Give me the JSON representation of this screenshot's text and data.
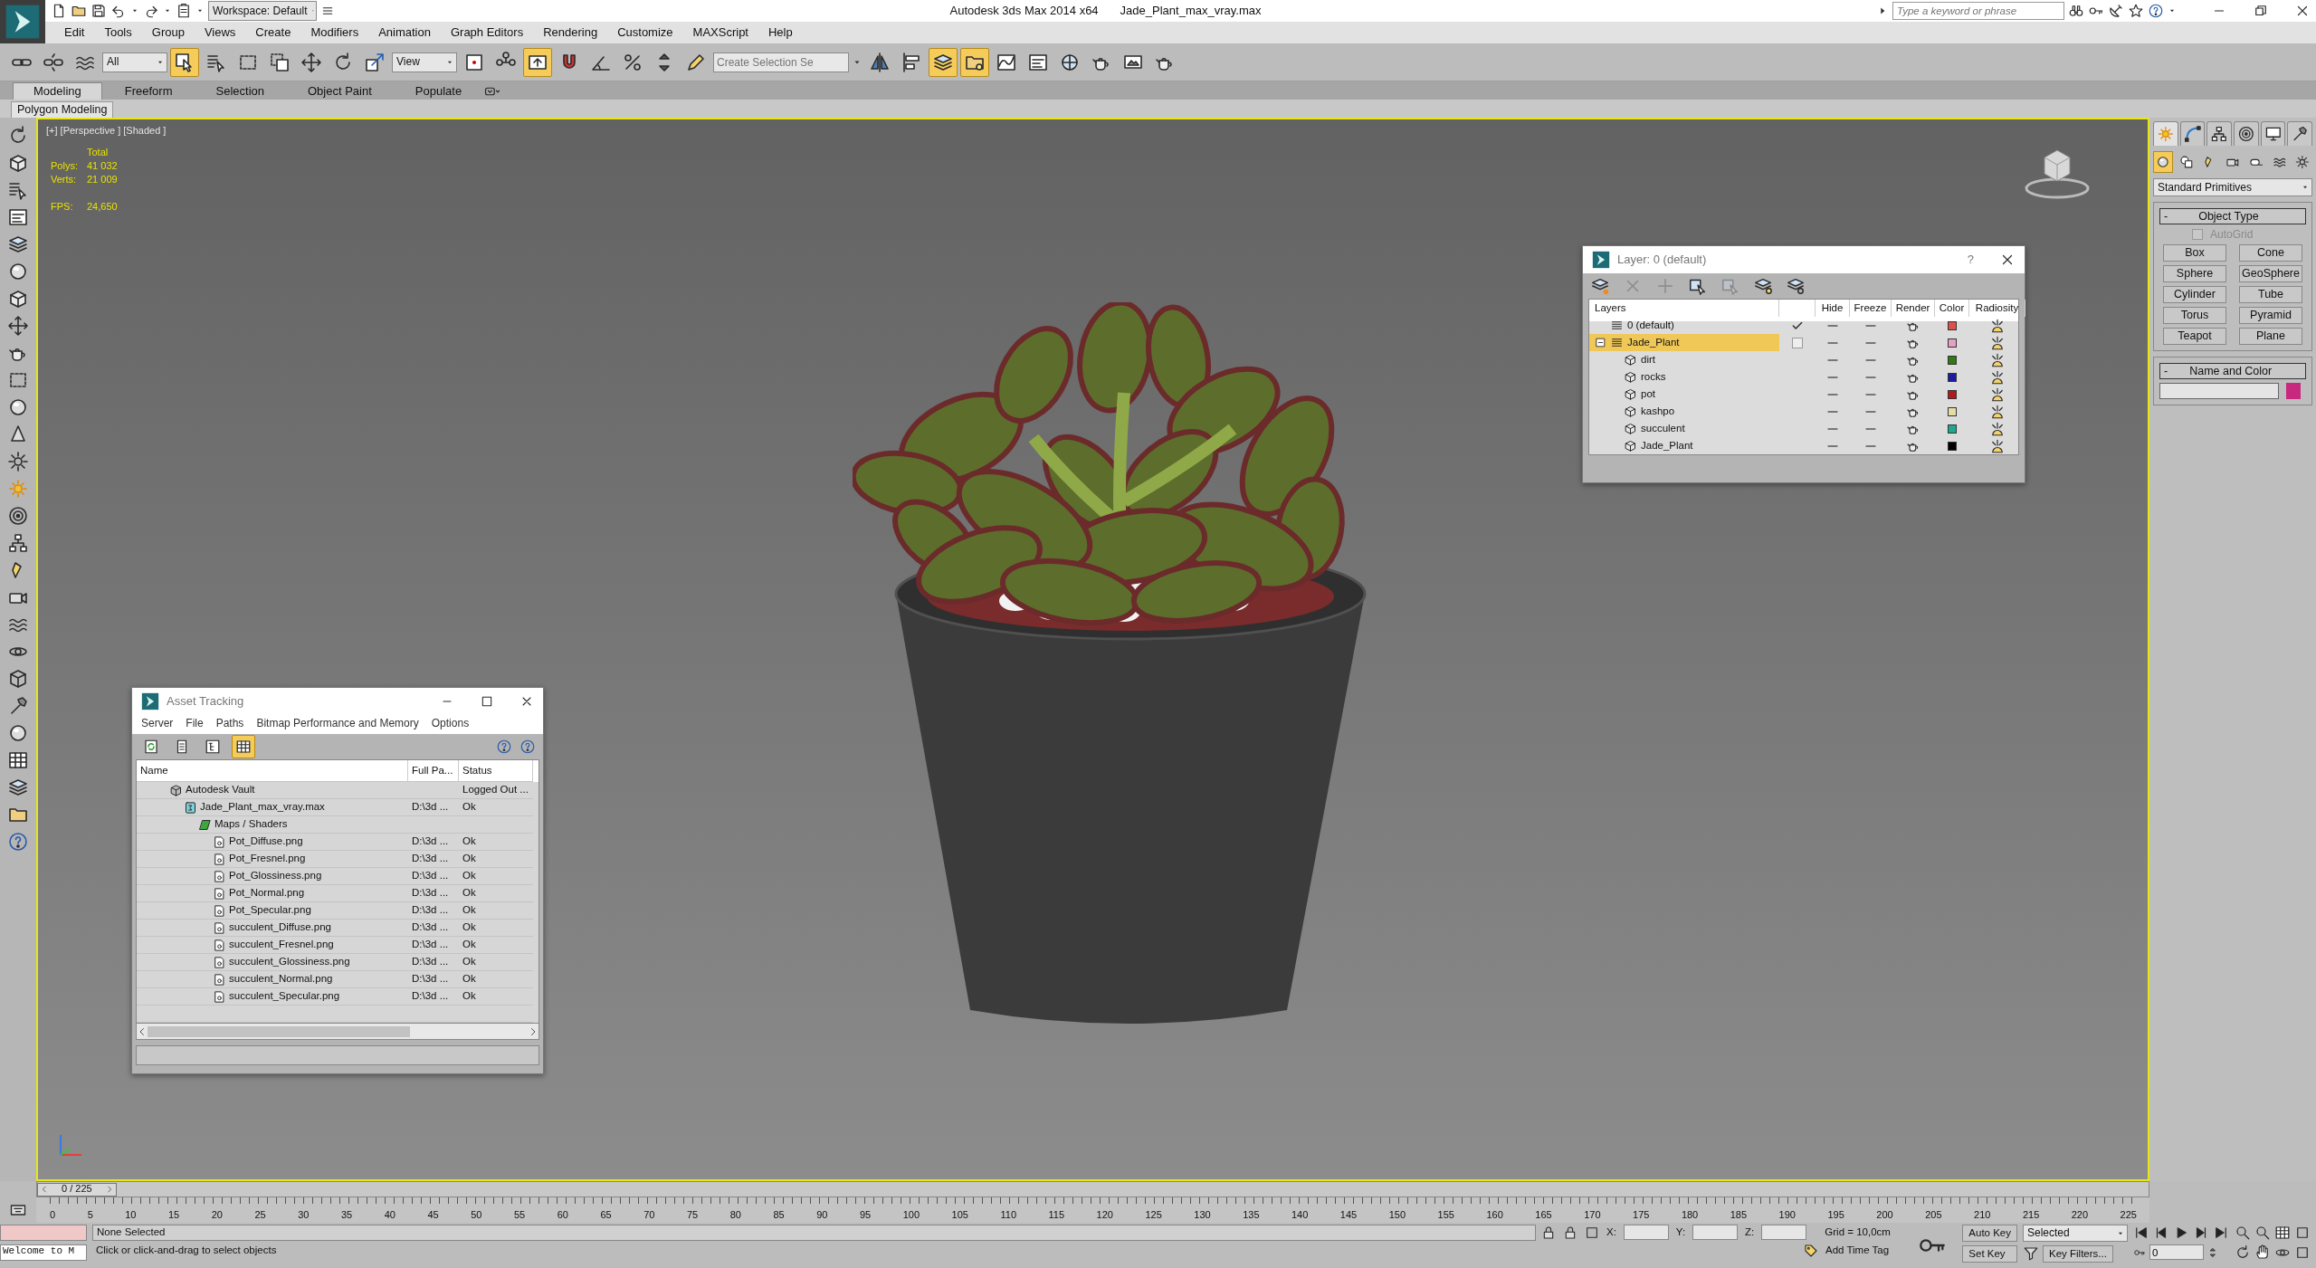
{
  "window": {
    "title": "Autodesk 3ds Max  2014 x64",
    "file": "Jade_Plant_max_vray.max",
    "workspace": "Workspace: Default",
    "search": {
      "placeholder": "Type a keyword or phrase"
    }
  },
  "menu": [
    "Edit",
    "Tools",
    "Group",
    "Views",
    "Create",
    "Modifiers",
    "Animation",
    "Graph Editors",
    "Rendering",
    "Customize",
    "MAXScript",
    "Help"
  ],
  "toolbar": [
    {
      "kind": "link",
      "on": false
    },
    {
      "kind": "unlink",
      "on": false
    },
    {
      "kind": "bind",
      "on": false
    },
    {
      "kind": "dropdown",
      "value": "All"
    },
    {
      "kind": "select",
      "on": true
    },
    {
      "kind": "select_by_name",
      "on": false
    },
    {
      "kind": "region",
      "on": false
    },
    {
      "kind": "crossing",
      "on": false
    },
    {
      "kind": "move",
      "on": false
    },
    {
      "kind": "rotate",
      "on": false
    },
    {
      "kind": "scale",
      "on": false
    },
    {
      "kind": "dropdown",
      "value": "View"
    },
    {
      "kind": "pivot",
      "on": false
    },
    {
      "kind": "manipulate",
      "on": false
    },
    {
      "kind": "shortcut",
      "on": true
    },
    {
      "kind": "snap",
      "on": false
    },
    {
      "kind": "angle_snap",
      "on": false
    },
    {
      "kind": "percent_snap",
      "on": false
    },
    {
      "kind": "spinner_snap",
      "on": false
    },
    {
      "kind": "named_sets",
      "on": false
    },
    {
      "kind": "field",
      "placeholder": "Create Selection Se"
    },
    {
      "kind": "mirror",
      "on": false
    },
    {
      "kind": "align",
      "on": false
    },
    {
      "kind": "layers",
      "on": true
    },
    {
      "kind": "explorer",
      "on": true
    },
    {
      "kind": "curve_editor",
      "on": false
    },
    {
      "kind": "schematic",
      "on": false
    },
    {
      "kind": "material_editor",
      "on": false
    },
    {
      "kind": "render_setup",
      "on": false
    },
    {
      "kind": "frame_window",
      "on": false
    },
    {
      "kind": "render",
      "on": false
    }
  ],
  "ribbon": {
    "tabs": [
      {
        "label": "Modeling",
        "selected": true
      },
      {
        "label": "Freeform",
        "selected": false
      },
      {
        "label": "Selection",
        "selected": false
      },
      {
        "label": "Object Paint",
        "selected": false
      },
      {
        "label": "Populate",
        "selected": false
      }
    ],
    "panel": "Polygon Modeling"
  },
  "viewport": {
    "label": "[+] [Perspective ] [Shaded ]",
    "stats": {
      "header": "Total",
      "rows": [
        {
          "label": "Polys:",
          "value": "41 032"
        },
        {
          "label": "Verts:",
          "value": "21 009"
        },
        {
          "label": "FPS:",
          "value": "24,650"
        }
      ]
    }
  },
  "layer_dialog": {
    "title": "Layer: 0 (default)",
    "help": "?",
    "toolbar": [
      {
        "kind": "new",
        "disabled": false
      },
      {
        "kind": "delete",
        "disabled": true
      },
      {
        "kind": "add",
        "disabled": true
      },
      {
        "kind": "select",
        "disabled": false
      },
      {
        "kind": "highlight",
        "disabled": true
      },
      {
        "kind": "hide_all",
        "disabled": false
      },
      {
        "kind": "freeze_all",
        "disabled": false
      }
    ],
    "columns": [
      "Layers",
      "Hide",
      "Freeze",
      "Render",
      "Color",
      "Radiosity"
    ],
    "layers": [
      {
        "name": "0 (default)",
        "current": true,
        "selected": false,
        "expanded": false,
        "color": "#dc5050"
      },
      {
        "name": "Jade_Plant",
        "current": false,
        "selected": true,
        "expanded": true,
        "color": "#e6a0c2",
        "children": [
          {
            "name": "dirt",
            "color": "#2f7a12"
          },
          {
            "name": "rocks",
            "color": "#1c1ca0"
          },
          {
            "name": "pot",
            "color": "#b01a1a"
          },
          {
            "name": "kashpo",
            "color": "#e6dca6"
          },
          {
            "name": "succulent",
            "color": "#1fa88e"
          },
          {
            "name": "Jade_Plant",
            "color": "#000000"
          }
        ]
      }
    ]
  },
  "asset_tracking": {
    "title": "Asset Tracking",
    "menu": [
      "Server",
      "File",
      "Paths",
      "Bitmap Performance and Memory",
      "Options"
    ],
    "toolbar": [
      {
        "kind": "refresh",
        "on": false
      },
      {
        "kind": "list",
        "on": false
      },
      {
        "kind": "tree",
        "on": false
      },
      {
        "kind": "table",
        "on": true
      }
    ],
    "columns": [
      "Name",
      "Full Pa...",
      "Status"
    ],
    "items": [
      {
        "kind": "vault",
        "name": "Autodesk Vault",
        "status": "Logged Out ...",
        "children": [
          {
            "kind": "scene",
            "name": "Jade_Plant_max_vray.max",
            "path": "D:\\3d ...",
            "status": "Ok",
            "children": [
              {
                "kind": "maps",
                "name": "Maps / Shaders",
                "children": [
                  {
                    "kind": "image",
                    "name": "Pot_Diffuse.png",
                    "path": "D:\\3d ...",
                    "status": "Ok"
                  },
                  {
                    "kind": "image",
                    "name": "Pot_Fresnel.png",
                    "path": "D:\\3d ...",
                    "status": "Ok"
                  },
                  {
                    "kind": "image",
                    "name": "Pot_Glossiness.png",
                    "path": "D:\\3d ...",
                    "status": "Ok"
                  },
                  {
                    "kind": "image",
                    "name": "Pot_Normal.png",
                    "path": "D:\\3d ...",
                    "status": "Ok"
                  },
                  {
                    "kind": "image",
                    "name": "Pot_Specular.png",
                    "path": "D:\\3d ...",
                    "status": "Ok"
                  },
                  {
                    "kind": "image",
                    "name": "succulent_Diffuse.png",
                    "path": "D:\\3d ...",
                    "status": "Ok"
                  },
                  {
                    "kind": "image",
                    "name": "succulent_Fresnel.png",
                    "path": "D:\\3d ...",
                    "status": "Ok"
                  },
                  {
                    "kind": "image",
                    "name": "succulent_Glossiness.png",
                    "path": "D:\\3d ...",
                    "status": "Ok"
                  },
                  {
                    "kind": "image",
                    "name": "succulent_Normal.png",
                    "path": "D:\\3d ...",
                    "status": "Ok"
                  },
                  {
                    "kind": "image",
                    "name": "succulent_Specular.png",
                    "path": "D:\\3d ...",
                    "status": "Ok"
                  }
                ]
              }
            ]
          }
        ]
      }
    ]
  },
  "command_panel": {
    "tabs": [
      {
        "kind": "create",
        "selected": true
      },
      {
        "kind": "modify",
        "selected": false
      },
      {
        "kind": "hierarchy",
        "selected": false
      },
      {
        "kind": "motion",
        "selected": false
      },
      {
        "kind": "display",
        "selected": false
      },
      {
        "kind": "utilities",
        "selected": false
      }
    ],
    "categories": [
      {
        "kind": "geometry",
        "selected": true
      },
      {
        "kind": "shapes",
        "selected": false
      },
      {
        "kind": "lights",
        "selected": false
      },
      {
        "kind": "cameras",
        "selected": false
      },
      {
        "kind": "helpers",
        "selected": false
      },
      {
        "kind": "space_warps",
        "selected": false
      },
      {
        "kind": "systems",
        "selected": false
      }
    ],
    "type": "Standard Primitives",
    "object_type": {
      "toggle": "-",
      "title": "Object Type",
      "autogrid": {
        "label": "AutoGrid",
        "checked": false,
        "disabled": true
      },
      "buttons": [
        "Box",
        "Cone",
        "Sphere",
        "GeoSphere",
        "Cylinder",
        "Tube",
        "Torus",
        "Pyramid",
        "Teapot",
        "Plane"
      ]
    },
    "name_and_color": {
      "toggle": "-",
      "title": "Name and Color",
      "color": "#c8287f"
    }
  },
  "timeline": {
    "position": "0 / 225",
    "level": 0,
    "ticks": [
      "0",
      "5",
      "10",
      "15",
      "20",
      "25",
      "30",
      "35",
      "40",
      "45",
      "50",
      "55",
      "60",
      "65",
      "70",
      "75",
      "80",
      "85",
      "90",
      "95",
      "100",
      "105",
      "110",
      "115",
      "120",
      "125",
      "130",
      "135",
      "140",
      "145",
      "150",
      "155",
      "160",
      "165",
      "170",
      "175",
      "180",
      "185",
      "190",
      "195",
      "200",
      "205",
      "210",
      "215",
      "220",
      "225"
    ]
  },
  "status_bar": {
    "listener": "Welcome to M",
    "selection": "None Selected",
    "prompt": "Click or click-and-drag to select objects",
    "coords": [
      "X:",
      "Y:",
      "Z:"
    ],
    "grid": "Grid = 10,0cm",
    "time_tag": "Add Time Tag",
    "auto_key": "Auto Key",
    "key_mode": "Selected",
    "set_key": "Set Key",
    "key_filters": "Key Filters...",
    "frame": "0"
  }
}
